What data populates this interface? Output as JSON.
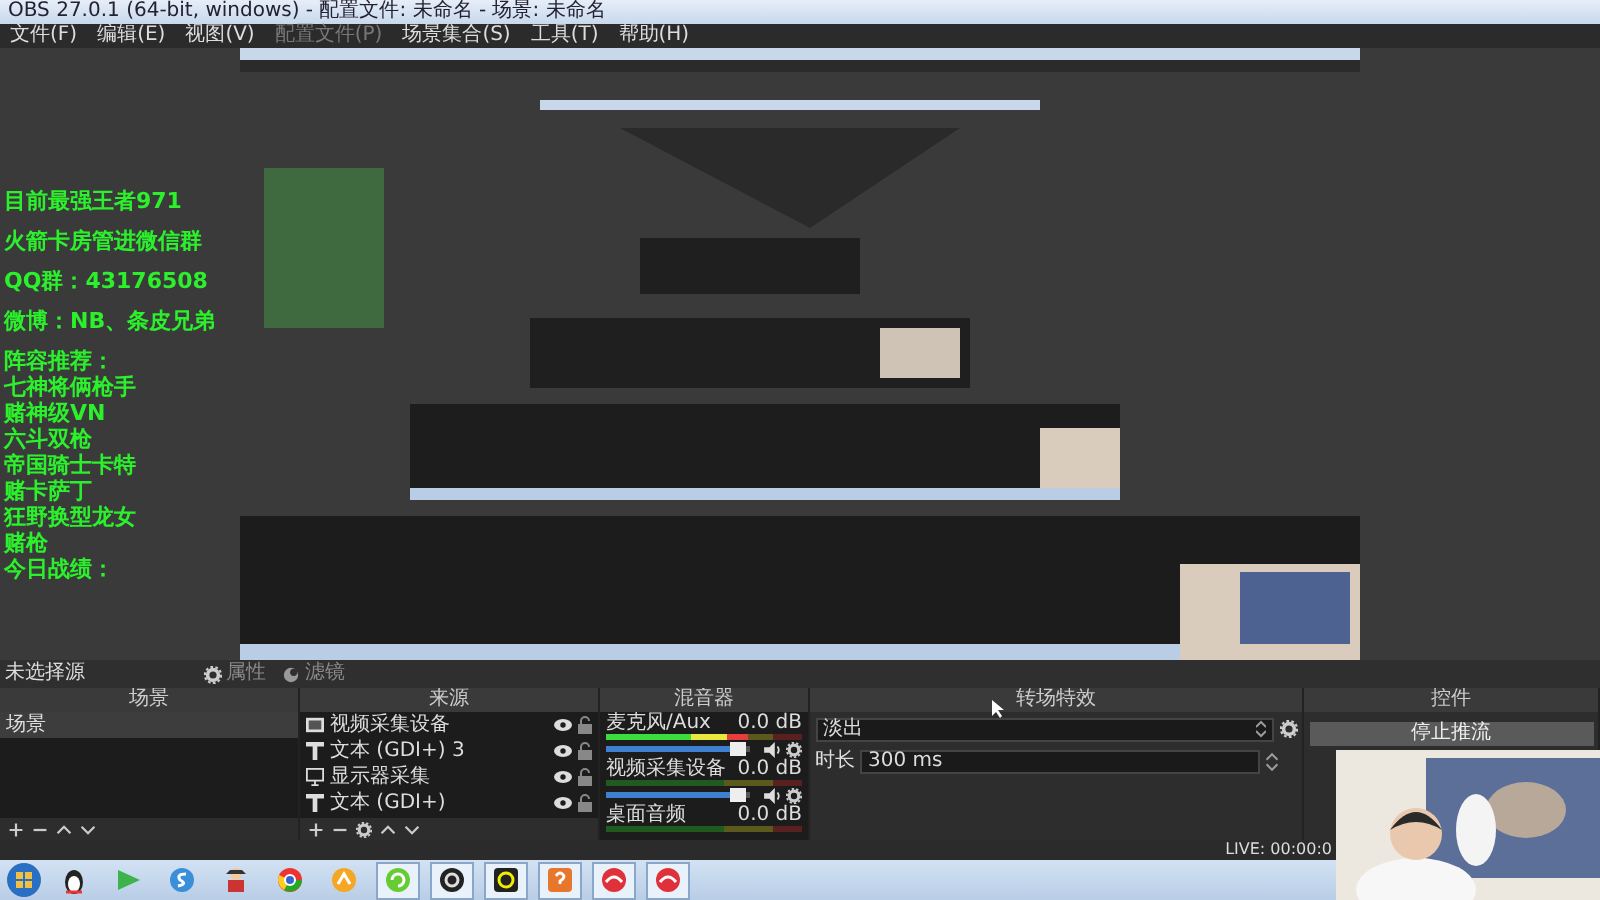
{
  "window": {
    "title": "OBS 27.0.1 (64-bit, windows) - 配置文件: 未命名 - 场景: 未命名"
  },
  "menu": [
    {
      "label": "文件(F)",
      "disabled": false
    },
    {
      "label": "编辑(E)",
      "disabled": false
    },
    {
      "label": "视图(V)",
      "disabled": false
    },
    {
      "label": "配置文件(P)",
      "disabled": true
    },
    {
      "label": "场景集合(S)",
      "disabled": false
    },
    {
      "label": "工具(T)",
      "disabled": false
    },
    {
      "label": "帮助(H)",
      "disabled": false
    }
  ],
  "preview": {
    "overlay_text": [
      "目前最强王者971",
      "火箭卡房管进微信群",
      "QQ群：43176508",
      "微博：NB、条皮兄弟"
    ],
    "lineup": [
      "阵容推荐：",
      "七神将俩枪手",
      "赌神级VN",
      "六斗双枪",
      "帝国骑士卡特",
      "赌卡萨丁",
      "狂野换型龙女",
      "赌枪",
      "今日战绩："
    ]
  },
  "context_bar": {
    "label": "未选择源",
    "buttons": [
      {
        "label": "属性",
        "disabled": true
      },
      {
        "label": "滤镜",
        "disabled": true
      }
    ]
  },
  "scenes": {
    "title": "场景",
    "items": [
      {
        "label": "场景",
        "selected": true
      }
    ]
  },
  "sources": {
    "title": "来源",
    "items": [
      {
        "kind": "camera",
        "label": "视频采集设备",
        "visible": true,
        "locked": false
      },
      {
        "kind": "text",
        "label": "文本 (GDI+) 3",
        "visible": true,
        "locked": false
      },
      {
        "kind": "monitor",
        "label": "显示器采集",
        "visible": true,
        "locked": false
      },
      {
        "kind": "text",
        "label": "文本 (GDI+)",
        "visible": true,
        "locked": false
      }
    ]
  },
  "mixer": {
    "title": "混音器",
    "channels": [
      {
        "name": "麦克风/Aux",
        "reading": "0.0 dB",
        "meter": {
          "level": 0.72
        },
        "fader": {
          "level": 0.97
        }
      },
      {
        "name": "视频采集设备",
        "reading": "0.0 dB",
        "meter": {
          "level": 0
        },
        "fader": {
          "level": 0.97
        }
      },
      {
        "name": "桌面音频",
        "reading": "0.0 dB",
        "meter": {
          "level": 0
        }
      }
    ]
  },
  "transitions": {
    "title": "转场特效",
    "selected": "淡出",
    "duration_label": "时长",
    "duration": "300 ms"
  },
  "controls": {
    "title": "控件",
    "buttons": [
      "停止推流"
    ]
  },
  "status_bar": {
    "live": "LIVE: 00:00:0"
  },
  "taskbar": {
    "apps": [
      {
        "running": false
      },
      {
        "running": false
      },
      {
        "running": false
      },
      {
        "running": false
      },
      {
        "running": false
      },
      {
        "running": false
      },
      {
        "running": true
      },
      {
        "running": true
      },
      {
        "running": true
      },
      {
        "running": true
      },
      {
        "running": true
      },
      {
        "running": true
      }
    ]
  }
}
